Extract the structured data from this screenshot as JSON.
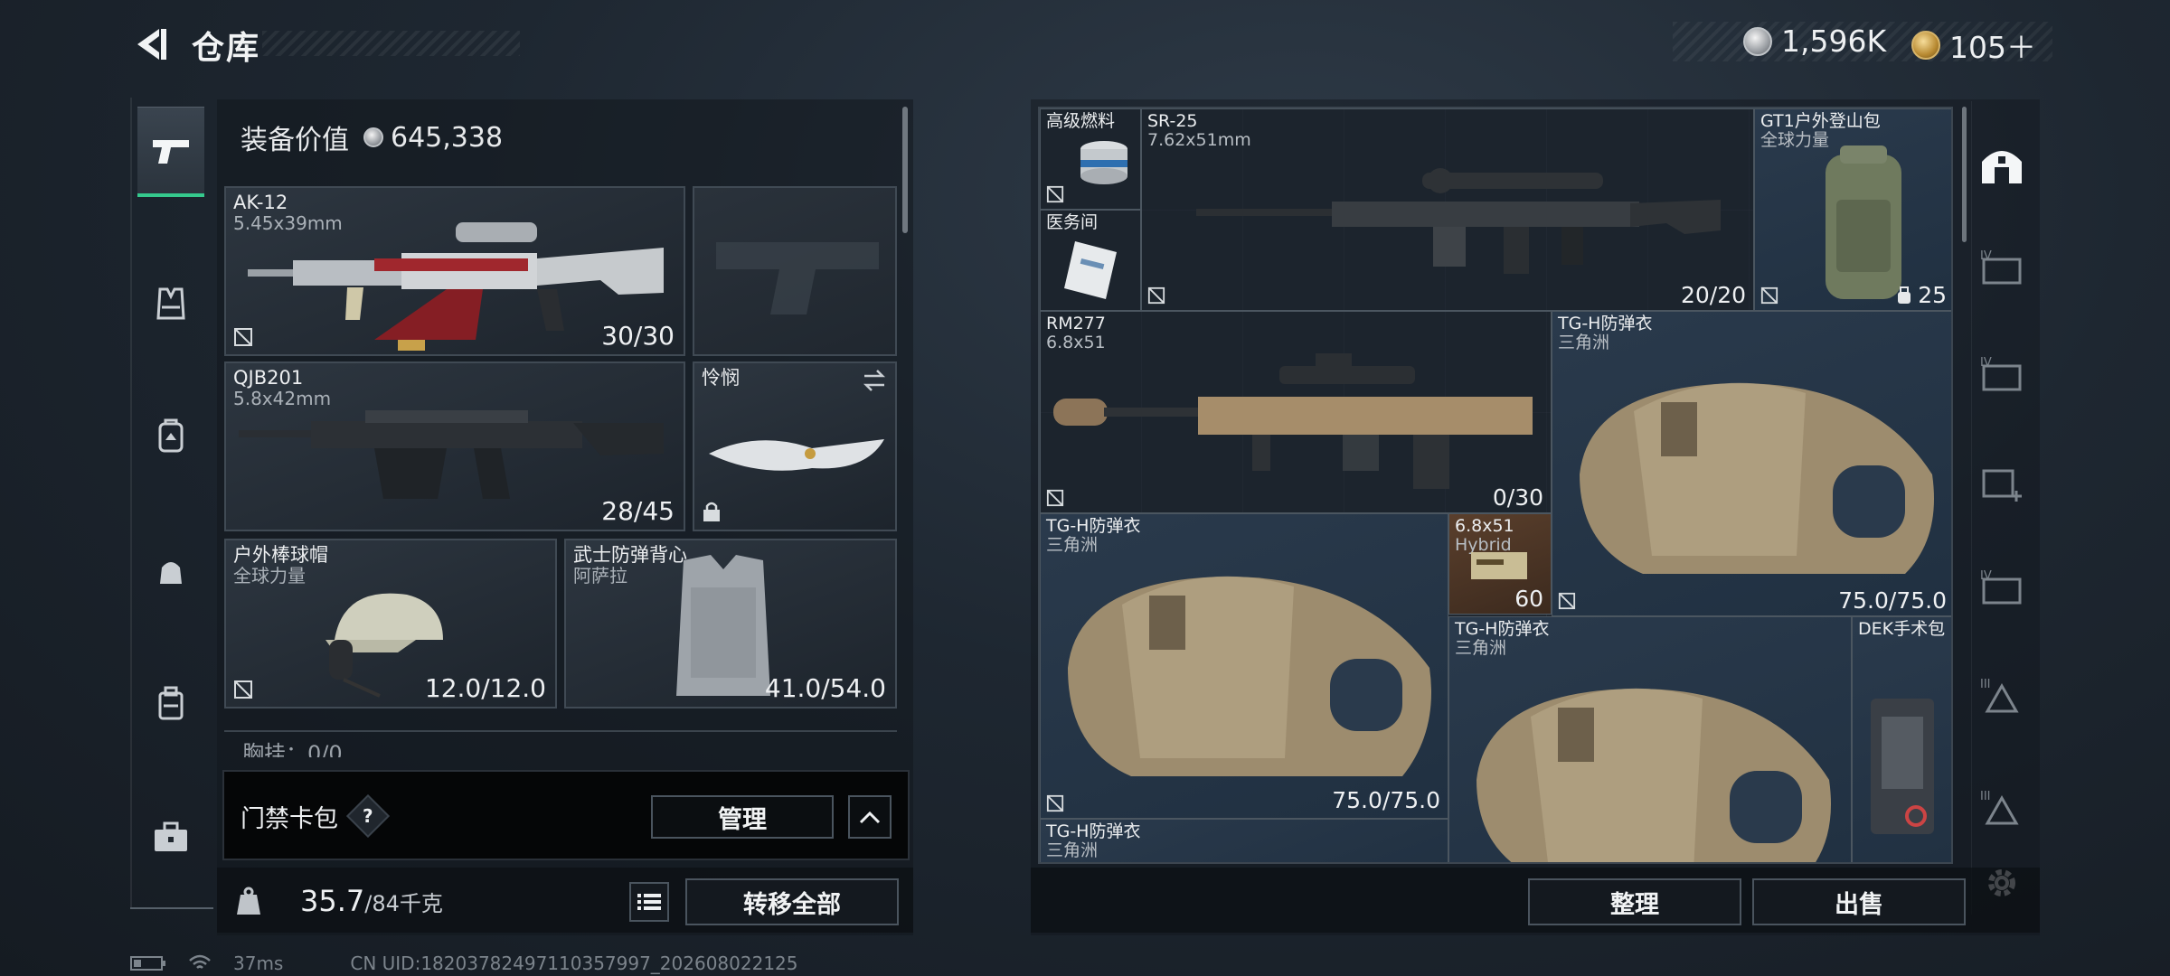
{
  "header": {
    "title": "仓库",
    "currency_silver": "1,596K",
    "currency_gold": "105＋"
  },
  "nav": {
    "items": [
      {
        "icon": "gun-icon",
        "active": true
      },
      {
        "icon": "vest-icon",
        "active": false
      },
      {
        "icon": "backpack-icon",
        "active": false
      },
      {
        "icon": "pouch-icon",
        "active": false
      },
      {
        "icon": "bag-icon",
        "active": false
      },
      {
        "icon": "toolbox-icon",
        "active": false
      }
    ]
  },
  "left": {
    "equip_value_label": "装备价值",
    "equip_value": "645,338",
    "slots": {
      "primary": {
        "name": "AK-12",
        "caliber": "5.45x39mm",
        "ammo": "30/30"
      },
      "secondary": {
        "name": "QJB201",
        "caliber": "5.8x42mm",
        "ammo": "28/45"
      },
      "knife": {
        "name": "怜悯"
      },
      "helmet": {
        "name": "户外棒球帽",
        "sub": "全球力量",
        "durability": "12.0/12.0"
      },
      "armor": {
        "name": "武士防弹背心",
        "sub": "阿萨拉",
        "durability": "41.0/54.0"
      }
    },
    "cut_row": "胸挂：0/0",
    "keycard_label": "门禁卡包",
    "manage_label": "管理",
    "weight_current": "35.7",
    "weight_max": "/84千克",
    "transfer_all_label": "转移全部"
  },
  "stash": {
    "items": {
      "fuel": {
        "name": "高级燃料"
      },
      "medkit": {
        "name": "医务间"
      },
      "sr25": {
        "name": "SR-25",
        "caliber": "7.62x51mm",
        "ammo": "20/20"
      },
      "backpack": {
        "name": "GT1户外登山包",
        "sub": "全球力量",
        "capacity": "25"
      },
      "rm277": {
        "name": "RM277",
        "caliber": "6.8x51",
        "ammo": "0/30"
      },
      "tgh1": {
        "name": "TG-H防弹衣",
        "sub": "三角洲",
        "durability": "75.0/75.0"
      },
      "tgh2": {
        "name": "TG-H防弹衣",
        "sub": "三角洲",
        "durability": "75.0/75.0"
      },
      "ammo": {
        "name": "6.8x51",
        "sub": "Hybrid",
        "count": "60"
      },
      "tgh3": {
        "name": "TG-H防弹衣",
        "sub": "三角洲"
      },
      "dek": {
        "name": "DEK手术包"
      },
      "tgh4": {
        "name": "TG-H防弹衣",
        "sub": "三角洲"
      }
    },
    "sort_label": "整理",
    "sell_label": "出售"
  },
  "right_rail": {
    "labels": [
      "IV",
      "IV",
      "",
      "IV",
      "III",
      "III"
    ]
  },
  "footer": {
    "ping": "37ms",
    "uid": "CN UID:18203782497110357997_202608022125"
  },
  "colors": {
    "accent_green": "#35c98d",
    "armor_bg": "#2a3a4c",
    "ammo_bg": "#5a3f2c"
  }
}
